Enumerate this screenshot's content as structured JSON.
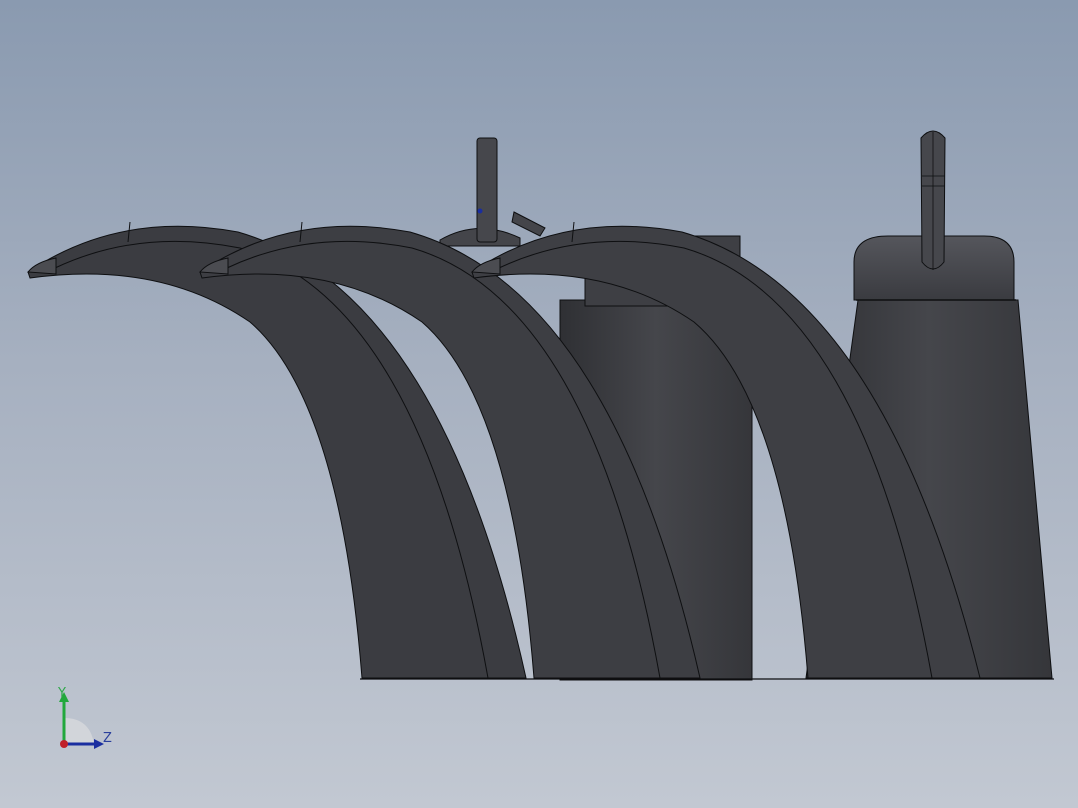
{
  "viewport": {
    "background_top": "#8a9ab0",
    "background_bottom": "#c2c8d2",
    "model_color": "#3c3d42",
    "edge_color": "#0e0f11"
  },
  "model": {
    "description_icon": "faucet-assembly-model",
    "spout_count": 3
  },
  "triad": {
    "y_label": "Y",
    "z_label": "Z",
    "y_color": "#22a83c",
    "z_color": "#1a2ea0",
    "x_color": "#c0202a"
  }
}
